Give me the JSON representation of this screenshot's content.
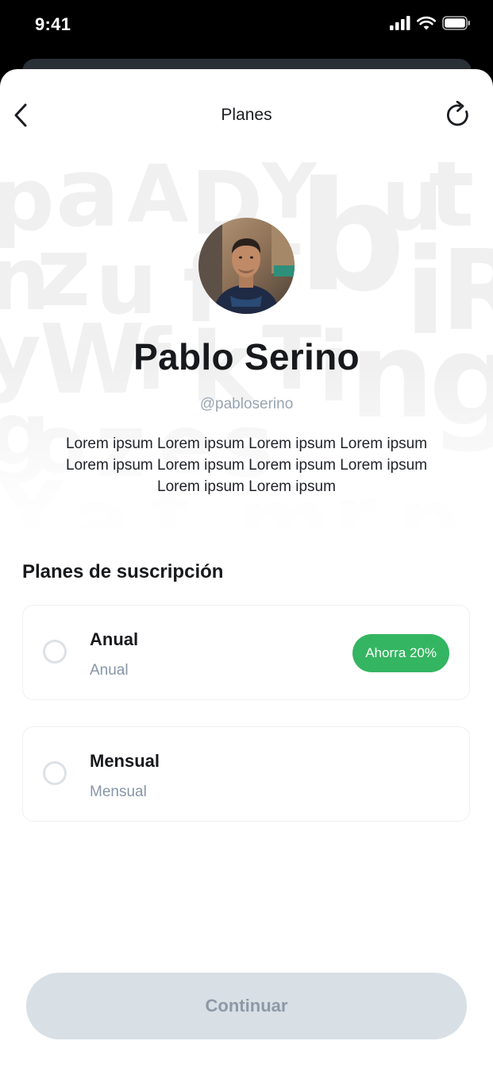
{
  "status_bar": {
    "time": "9:41"
  },
  "nav": {
    "title": "Planes"
  },
  "profile": {
    "name": "Pablo Serino",
    "handle": "@pabloserino",
    "bio": "Lorem ipsum Lorem ipsum Lorem ipsum Lorem ipsum Lorem ipsum Lorem ipsum Lorem ipsum Lorem ipsum Lorem ipsum Lorem ipsum"
  },
  "plans": {
    "section_title": "Planes de suscripción",
    "items": [
      {
        "name": "Anual",
        "subtitle": "Anual",
        "badge": "Ahorra 20%",
        "selected": false
      },
      {
        "name": "Mensual",
        "subtitle": "Mensual",
        "selected": false
      }
    ]
  },
  "footer": {
    "continue_label": "Continuar"
  },
  "colors": {
    "badge_green": "#34b561",
    "button_disabled_bg": "#d8dfe5",
    "button_disabled_text": "#8d99a6",
    "muted_text": "#8696a8"
  },
  "icons": {
    "back": "chevron-left-icon",
    "refresh": "refresh-icon",
    "signal": "signal-icon",
    "wifi": "wifi-icon",
    "battery": "battery-icon"
  }
}
